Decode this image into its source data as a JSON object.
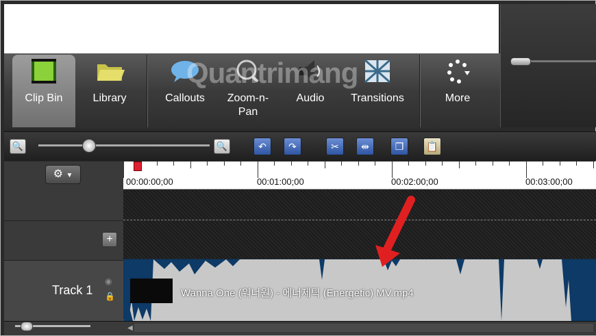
{
  "toolbar": {
    "items": [
      {
        "label": "Clip Bin",
        "icon": "film-strip-icon",
        "selected": true
      },
      {
        "label": "Library",
        "icon": "folder-icon"
      },
      {
        "label": "Callouts",
        "icon": "speech-bubble-icon"
      },
      {
        "label": "Zoom-n-\nPan",
        "icon": "zoom-icon"
      },
      {
        "label": "Audio",
        "icon": "speaker-icon"
      },
      {
        "label": "Transitions",
        "icon": "transition-icon"
      },
      {
        "label": "More",
        "icon": "more-dots-icon"
      }
    ]
  },
  "watermark": "Quantrimang",
  "timeline": {
    "ruler_labels": [
      "00:00:00;00",
      "00:01:00;00",
      "00:02:00;00",
      "00:03:00;00"
    ],
    "track_name": "Track 1",
    "clip_name": "Wanna One (워너원) - 에너제틱 (Energetic) MV.mp4"
  },
  "colors": {
    "accent_arrow": "#e02020",
    "playhead": "#d22233",
    "waveform": "#0d3a66",
    "clip_bg": "#c8c8c8"
  }
}
